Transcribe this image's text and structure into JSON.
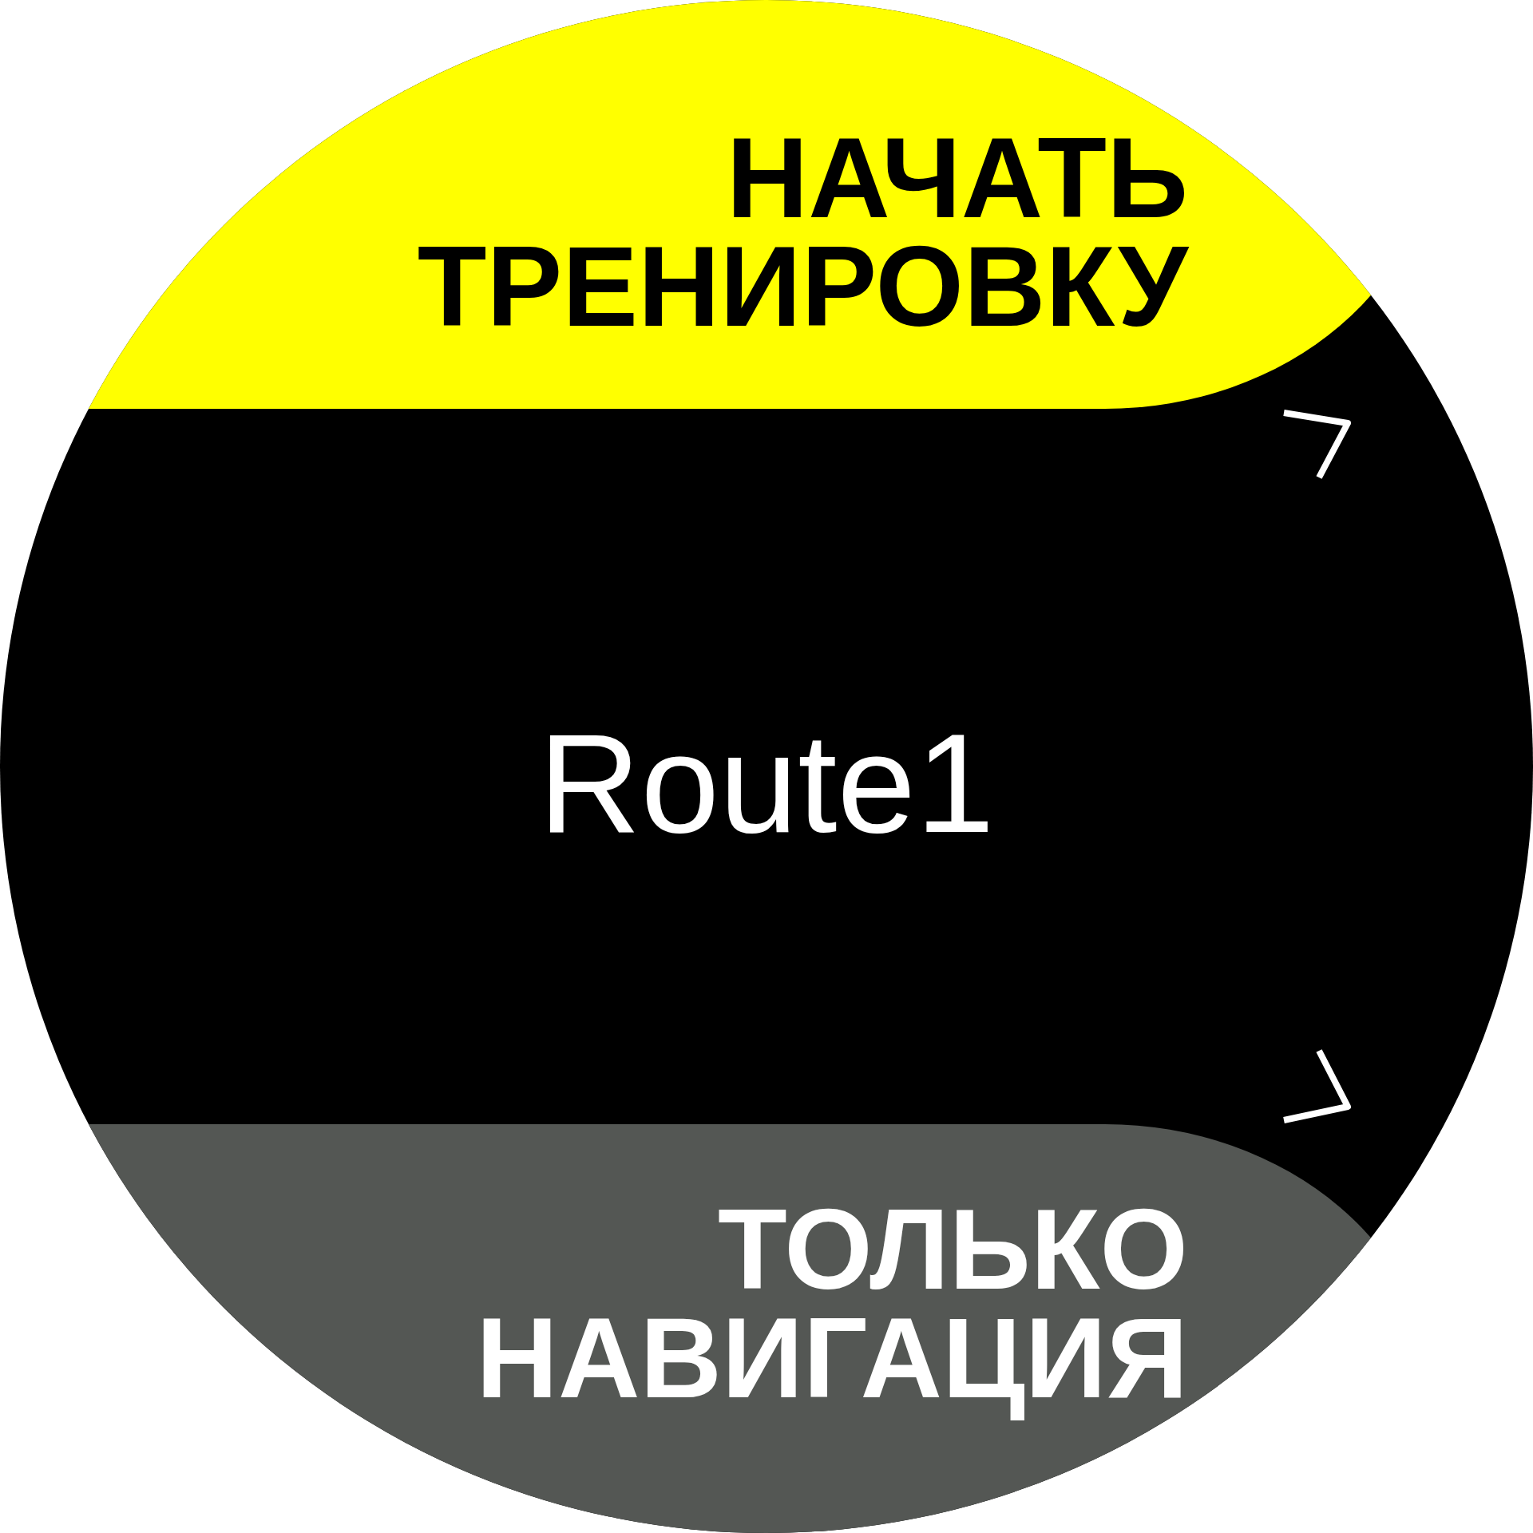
{
  "primary_action": {
    "label": "НАЧАТЬ ТРЕНИРОВКУ"
  },
  "title": "Route1",
  "secondary_action": {
    "label": "ТОЛЬКО НАВИГАЦИЯ"
  }
}
